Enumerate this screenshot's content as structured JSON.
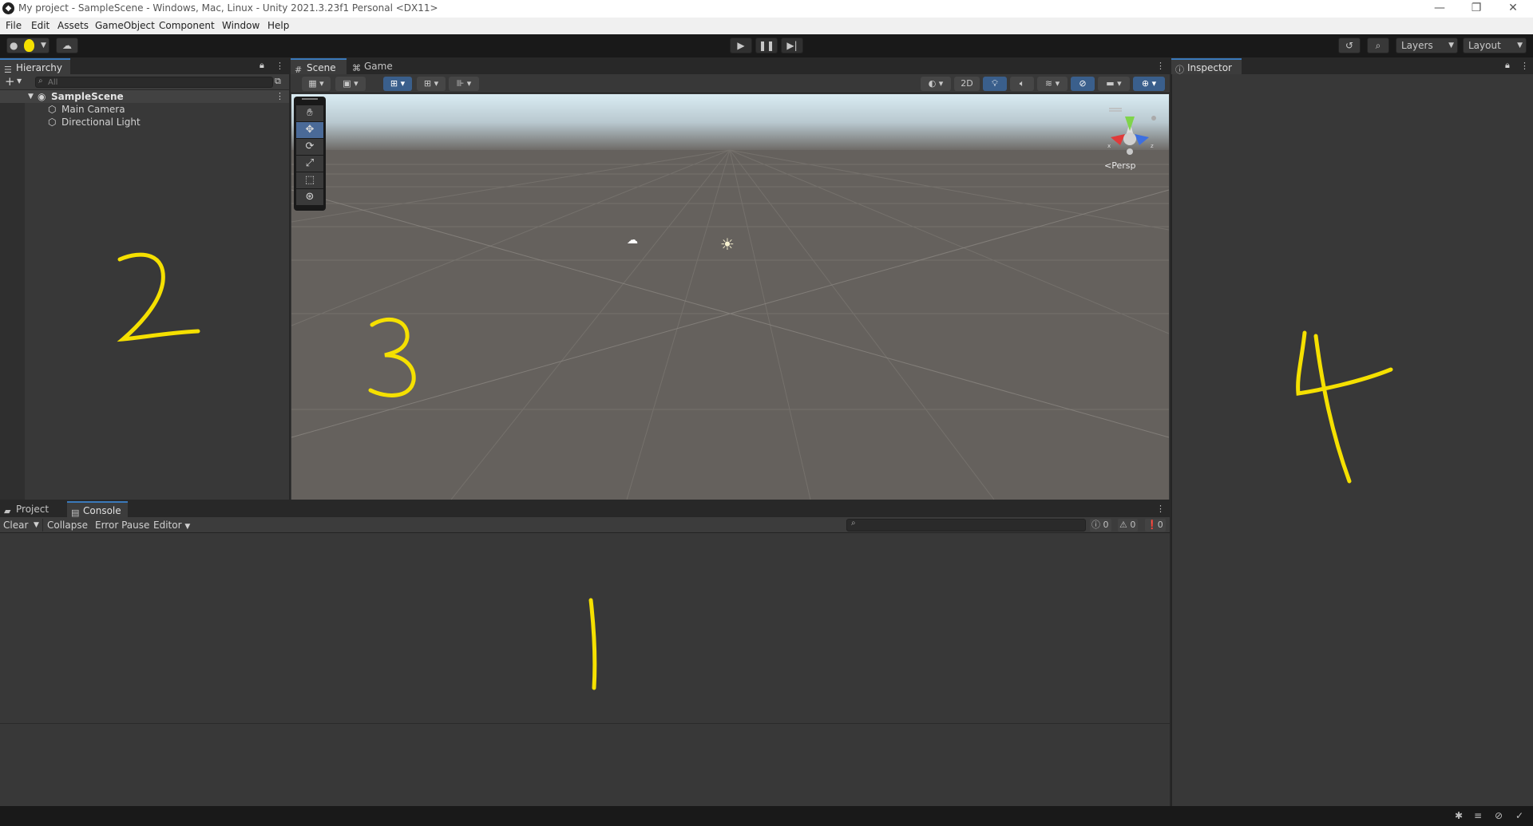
{
  "window": {
    "title": "My project - SampleScene - Windows, Mac, Linux - Unity 2021.3.23f1 Personal <DX11>",
    "controls": [
      "—",
      "❐",
      "✕"
    ]
  },
  "menu": [
    "File",
    "Edit",
    "Assets",
    "GameObject",
    "Component",
    "Window",
    "Help"
  ],
  "toolbar": {
    "layers_label": "Layers",
    "layout_label": "Layout"
  },
  "hierarchy": {
    "tab_label": "Hierarchy",
    "search_placeholder": "All",
    "scene_name": "SampleScene",
    "items": [
      "Main Camera",
      "Directional Light"
    ]
  },
  "scene_view": {
    "tabs": [
      "Scene",
      "Game"
    ],
    "mode_2d_label": "2D",
    "projection_label": "Persp",
    "gizmo_axes": [
      "x",
      "y",
      "z"
    ]
  },
  "inspector": {
    "tab_label": "Inspector"
  },
  "console": {
    "tabs": [
      "Project",
      "Console"
    ],
    "buttons": {
      "clear": "Clear",
      "collapse": "Collapse",
      "error_pause": "Error Pause",
      "editor": "Editor"
    },
    "counts": {
      "log": "0",
      "warning": "0",
      "error": "0"
    }
  },
  "annotations": {
    "console_label": "1",
    "hierarchy_label": "2",
    "scene_label": "3",
    "inspector_label": "4",
    "color": "#f5e000"
  },
  "icons": {
    "account": "account-icon",
    "cloud": "cloud-icon",
    "play": "play-icon",
    "pause": "pause-icon",
    "step": "step-icon",
    "history": "history-icon",
    "search": "search-icon",
    "lock": "lock-icon"
  }
}
